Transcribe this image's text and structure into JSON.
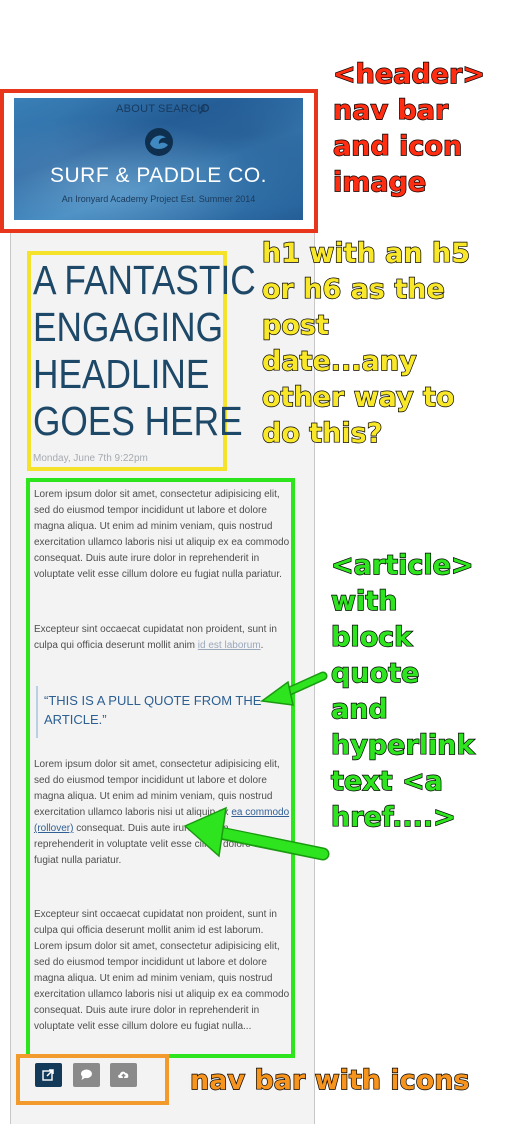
{
  "header": {
    "nav": {
      "about": "ABOUT",
      "search": "SEARCH"
    },
    "title": "SURF & PADDLE CO.",
    "tagline": "An Ironyard Academy Project Est. Summer 2014",
    "icons": {
      "search": "search-icon",
      "logo": "wave-logo-icon"
    }
  },
  "post": {
    "headline_lines": [
      "A FANTASTIC",
      "ENGAGING",
      "HEADLINE",
      "GOES HERE"
    ],
    "date": "Monday, June 7th 9:22pm"
  },
  "article": {
    "p1": "Lorem ipsum dolor sit amet, consectetur adipisicing elit, sed do eiusmod tempor incididunt ut labore et dolore magna aliqua. Ut enim ad minim veniam, quis nostrud exercitation ullamco laboris nisi ut aliquip ex ea commodo consequat. Duis aute irure dolor in reprehenderit in voluptate velit esse cillum dolore eu fugiat nulla pariatur.",
    "p2_text": "Excepteur sint occaecat cupidatat non proident, sunt in culpa qui officia deserunt mollit anim ",
    "p2_link": "id est laborum",
    "p2_end": ".",
    "pull_quote": "“THIS IS A PULL QUOTE FROM THE ARTICLE.”",
    "p3_before": "Lorem ipsum dolor sit amet, consectetur adipisicing elit, sed do eiusmod tempor incididunt ut labore et dolore magna aliqua. Ut enim ad minim veniam, quis nostrud exercitation ullamco laboris nisi ut aliquip ex ",
    "p3_link": "ea commodo (rollover)",
    "p3_after": " consequat. Duis aute irure dolor in reprehenderit in voluptate velit esse cillum dolore eu fugiat nulla pariatur.",
    "p4": "Excepteur sint occaecat cupidatat non proident, sunt in culpa qui officia deserunt mollit anim id est laborum. Lorem ipsum dolor sit amet, consectetur adipisicing elit, sed do eiusmod tempor incididunt ut labore et dolore magna aliqua. Ut enim ad minim veniam, quis nostrud exercitation ullamco laboris nisi ut aliquip ex ea commodo consequat. Duis aute irure dolor in reprehenderit in voluptate velit esse cillum dolore eu fugiat nulla..."
  },
  "icon_nav": [
    {
      "name": "share-icon",
      "color": "#143a5a"
    },
    {
      "name": "comment-icon",
      "color": "#8a8a8a"
    },
    {
      "name": "upload-cloud-icon",
      "color": "#8a8a8a"
    }
  ],
  "annotations": {
    "header": [
      "<header>",
      "nav bar",
      "and icon",
      "image"
    ],
    "headline": [
      "h1 with an h5",
      "or h6 as the",
      "post",
      "date...any",
      "other way to",
      "do this?"
    ],
    "article": [
      "<article>",
      "with",
      "block",
      "quote",
      "and",
      "hyperlink",
      "text <a",
      "href....>"
    ],
    "icon_nav": "nav bar with icons"
  },
  "colors": {
    "header_outline": "#e8361c",
    "headline_outline": "#f4e32a",
    "article_outline": "#2de41d",
    "iconnav_outline": "#f39a2c",
    "headline_text": "#1e4867",
    "link": "#2f5f95"
  }
}
